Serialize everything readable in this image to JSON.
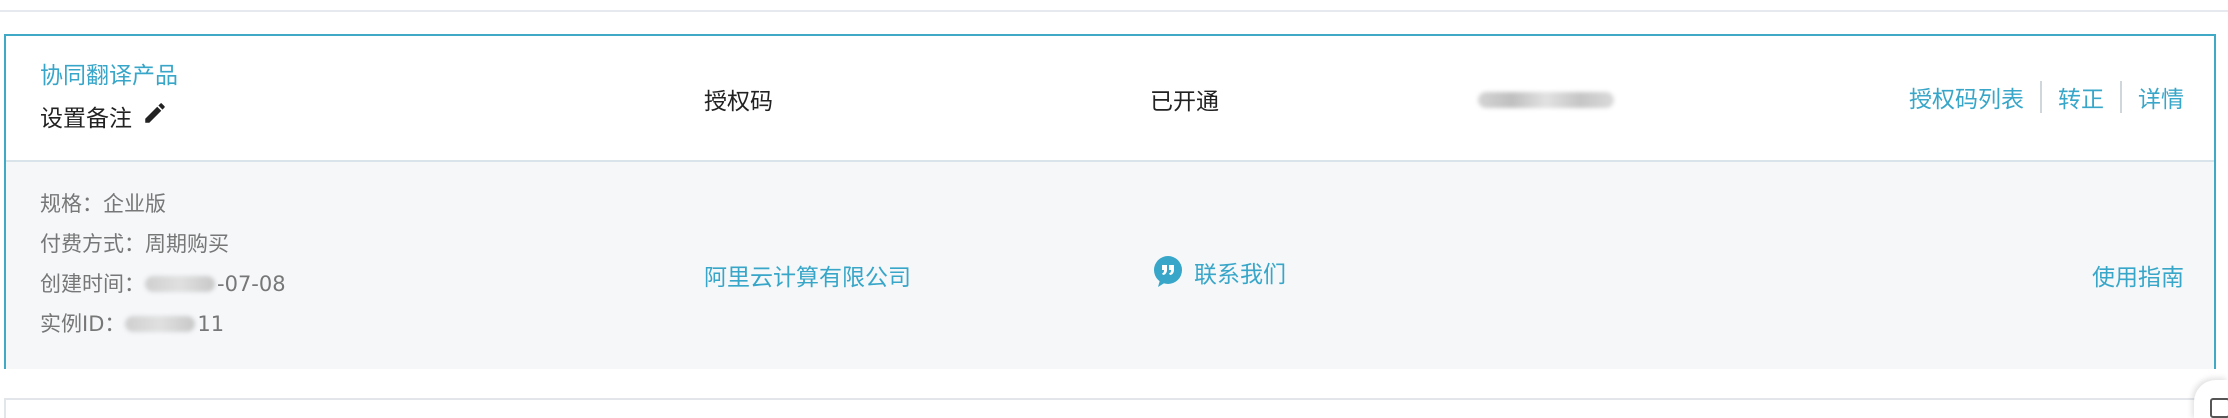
{
  "instance": {
    "product_name": "协同翻译产品",
    "remark_label": "设置备注",
    "auth_type": "授权码",
    "status": "已开通",
    "actions": {
      "license_list": "授权码列表",
      "convert": "转正",
      "details": "详情"
    },
    "specs": {
      "spec_label": "规格：",
      "spec_value": "企业版",
      "payment_label": "付费方式：",
      "payment_value": "周期购买",
      "created_label": "创建时间：",
      "created_value_visible": "-07-08",
      "instance_id_label": "实例ID：",
      "instance_id_visible": "11"
    },
    "company": "阿里云计算有限公司",
    "contact": "联系我们",
    "guide": "使用指南"
  },
  "colors": {
    "accent": "#37a6c8",
    "border_active": "#3fa9c6",
    "body_bg": "#f5f7f9",
    "muted_text": "#777777"
  },
  "icons": {
    "edit": "pencil-icon",
    "contact": "quote-bubble-icon"
  }
}
